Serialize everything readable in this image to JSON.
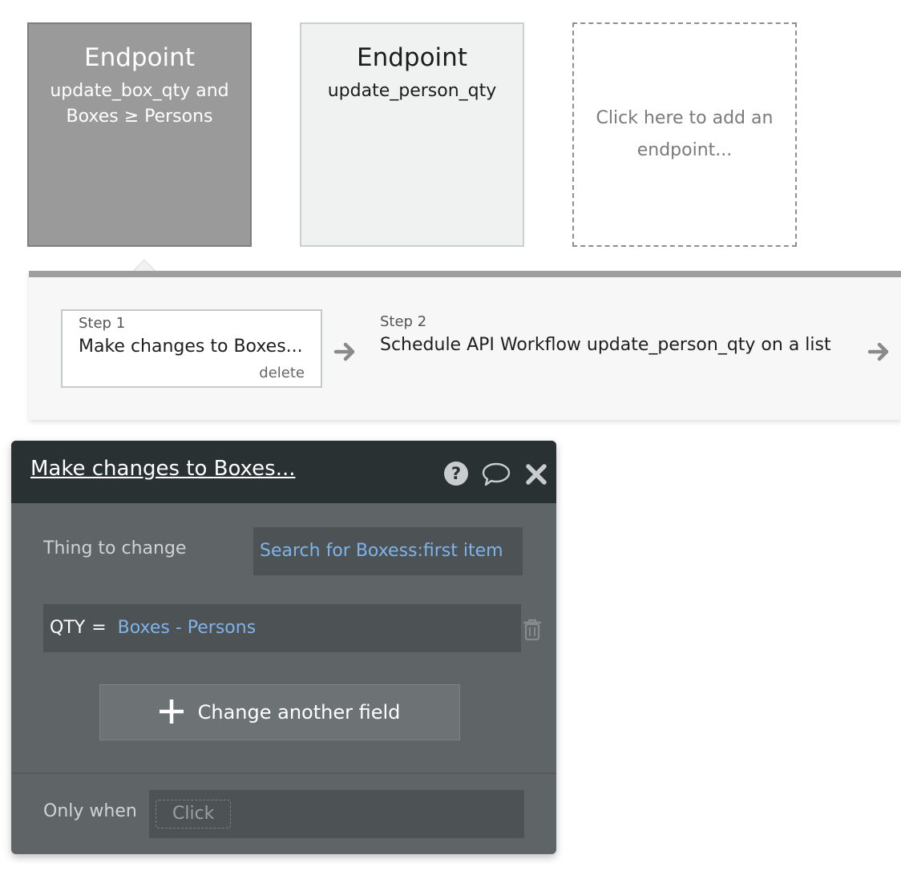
{
  "endpoints": [
    {
      "title": "Endpoint",
      "name": "update_box_qty and Boxes ≥ Persons",
      "state": "selected"
    },
    {
      "title": "Endpoint",
      "name": "update_person_qty",
      "state": "normal"
    }
  ],
  "add_endpoint_label": "Click here to add an endpoint...",
  "workflow": {
    "steps": [
      {
        "label": "Step 1",
        "title": "Make changes to Boxes...",
        "delete_label": "delete"
      },
      {
        "label": "Step 2",
        "title": "Schedule API Workflow update_person_qty on a list"
      }
    ]
  },
  "editor": {
    "title": "Make changes to Boxes...",
    "icons": [
      "help-icon",
      "comment-icon",
      "close-icon"
    ],
    "thing_to_change_label": "Thing to change",
    "thing_to_change_value": "Search for Boxess:first item",
    "field_change": {
      "field": "QTY",
      "operator": "=",
      "value": "Boxes - Persons"
    },
    "change_another_label": "Change another field",
    "only_when_label": "Only when",
    "only_when_placeholder": "Click"
  },
  "colors": {
    "selected_card": "#9a9a9a",
    "panel_bg": "#5f6466",
    "panel_header": "#2a3133",
    "link_blue": "#7fb3ea"
  }
}
